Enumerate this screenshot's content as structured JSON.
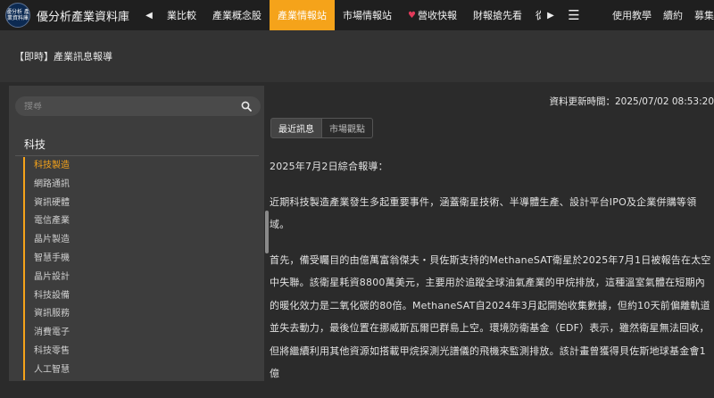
{
  "header": {
    "logo_text": "優分析 產業資料庫",
    "title": "優分析產業資料庫",
    "nav_left_arrow": "◀",
    "nav_right_arrow": "▶",
    "tabs": [
      {
        "label": "業比較"
      },
      {
        "label": "產業概念股"
      },
      {
        "label": "產業情報站"
      },
      {
        "label": "市場情報站"
      },
      {
        "label": "營收快報"
      },
      {
        "label": "財報搶先看"
      }
    ],
    "partial_tab": "從",
    "menu_icon": "☰",
    "right_links": [
      "使用教學",
      "續約",
      "募集"
    ]
  },
  "breadcrumb": "【即時】產業訊息報導",
  "sidebar": {
    "search_placeholder": "搜尋",
    "category_title": "科技",
    "items": [
      {
        "label": "科技製造"
      },
      {
        "label": "網路通訊"
      },
      {
        "label": "資訊硬體"
      },
      {
        "label": "電信產業"
      },
      {
        "label": "晶片製造"
      },
      {
        "label": "智慧手機"
      },
      {
        "label": "晶片設計"
      },
      {
        "label": "科技設備"
      },
      {
        "label": "資訊服務"
      },
      {
        "label": "消費電子"
      },
      {
        "label": "科技零售"
      },
      {
        "label": "人工智慧"
      }
    ]
  },
  "content": {
    "update_time": "資料更新時間：2025/07/02 08:53:20",
    "tabs": [
      {
        "label": "最近訊息"
      },
      {
        "label": "市場觀點"
      }
    ],
    "paragraphs": [
      "2025年7月2日綜合報導：",
      "近期科技製造產業發生多起重要事件，涵蓋衛星技術、半導體生產、設計平台IPO及企業併購等領域。",
      "首先，備受矚目的由億萬富翁傑夫・貝佐斯支持的MethaneSAT衛星於2025年7月1日被報告在太空中失聯。該衛星耗資8800萬美元，主要用於追蹤全球油氣產業的甲烷排放，這種溫室氣體在短期內的暖化效力是二氧化碳的80倍。MethaneSAT自2024年3月起開始收集數據，但約10天前偏離軌道並失去動力，最後位置在挪威斯瓦爾巴群島上空。環境防衛基金（EDF）表示，雖然衛星無法回收，但將繼續利用其他資源如搭載甲烷探測光譜儀的飛機來監測排放。該計畫曾獲得貝佐斯地球基金會1億"
    ]
  },
  "colors": {
    "accent": "#f5a31a",
    "topbar_bg": "#1f1f1f",
    "page_bg": "#2b2b2b",
    "sidebar_bg": "#3d3d3d"
  }
}
